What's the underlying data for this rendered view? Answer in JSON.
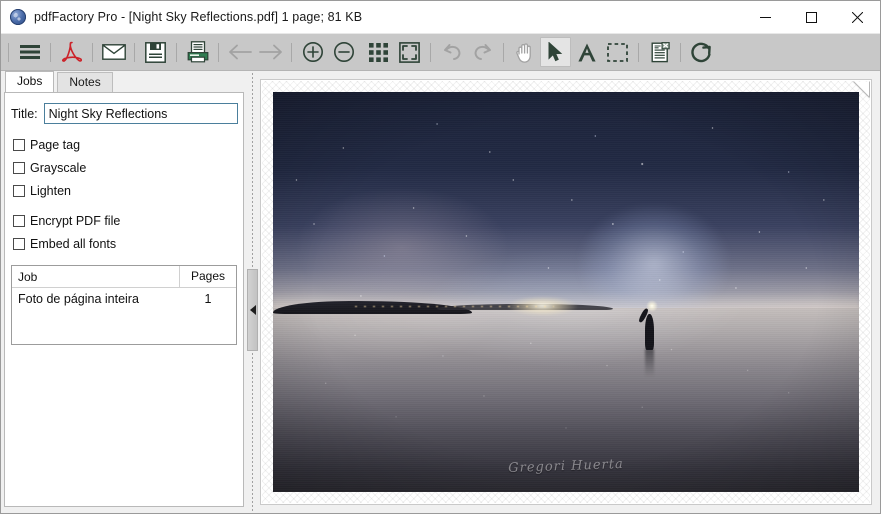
{
  "window": {
    "title": "pdfFactory Pro - [Night Sky Reflections.pdf] 1 page; 81 KB",
    "app_icon": "pdffactory-globe-icon",
    "controls": {
      "minimize": "minimize-button",
      "maximize": "maximize-button",
      "close": "close-button"
    }
  },
  "toolbar": {
    "items": [
      {
        "name": "menu-icon",
        "label": "Menu",
        "state": "enabled"
      },
      {
        "name": "adobe-pdf-icon",
        "label": "Open in Acrobat",
        "state": "enabled"
      },
      {
        "name": "envelope-icon",
        "label": "Send as e-mail",
        "state": "enabled"
      },
      {
        "name": "save-icon",
        "label": "Save",
        "state": "enabled"
      },
      {
        "name": "print-icon",
        "label": "Print",
        "state": "enabled"
      },
      {
        "name": "arrow-left-icon",
        "label": "Previous page",
        "state": "disabled"
      },
      {
        "name": "arrow-right-icon",
        "label": "Next page",
        "state": "disabled"
      },
      {
        "name": "zoom-in-icon",
        "label": "Zoom in",
        "state": "enabled"
      },
      {
        "name": "zoom-out-icon",
        "label": "Zoom out",
        "state": "enabled"
      },
      {
        "name": "grid-icon",
        "label": "Thumbnails",
        "state": "enabled"
      },
      {
        "name": "fit-page-icon",
        "label": "Fit page",
        "state": "enabled"
      },
      {
        "name": "undo-icon",
        "label": "Undo",
        "state": "disabled"
      },
      {
        "name": "redo-icon",
        "label": "Redo",
        "state": "disabled"
      },
      {
        "name": "hand-icon",
        "label": "Pan tool",
        "state": "disabled"
      },
      {
        "name": "cursor-icon",
        "label": "Select tool",
        "state": "active"
      },
      {
        "name": "text-tool-icon",
        "label": "Text tool",
        "state": "enabled"
      },
      {
        "name": "marquee-icon",
        "label": "Marquee select",
        "state": "enabled"
      },
      {
        "name": "delete-page-icon",
        "label": "Delete page",
        "state": "enabled"
      },
      {
        "name": "refresh-icon",
        "label": "Refresh",
        "state": "enabled"
      }
    ]
  },
  "left_panel": {
    "tabs": [
      {
        "label": "Jobs",
        "active": true
      },
      {
        "label": "Notes",
        "active": false
      }
    ],
    "title_field": {
      "label": "Title:",
      "value": "Night Sky Reflections",
      "placeholder": ""
    },
    "checkboxes": [
      {
        "label": "Page tag",
        "checked": false
      },
      {
        "label": "Grayscale",
        "checked": false
      },
      {
        "label": "Lighten",
        "checked": false
      },
      {
        "label": "Encrypt PDF file",
        "checked": false
      },
      {
        "label": "Embed all fonts",
        "checked": false
      }
    ],
    "job_table": {
      "headers": [
        "Job",
        "Pages"
      ],
      "rows": [
        {
          "job": "Foto de página inteira",
          "pages": "1"
        }
      ]
    }
  },
  "splitter": {
    "collapse_icon": "triangle-left-icon"
  },
  "document": {
    "page_count": "1",
    "photo": {
      "alt": "Milky Way arch reflected on a salt flat with a person holding a light",
      "signature": "Gregori Huerta"
    }
  },
  "colors": {
    "titlebar": "#ffffff",
    "toolbar": "#c8c8c8",
    "toolbar_icon": "#2f4438",
    "toolbar_icon_disabled": "#a2a2a2",
    "adobe_red": "#cc2229",
    "panel_bg": "#ffffff",
    "window_bg": "#f0f0f0",
    "input_border": "#4b7f9c",
    "close_hover": "#e81123"
  }
}
